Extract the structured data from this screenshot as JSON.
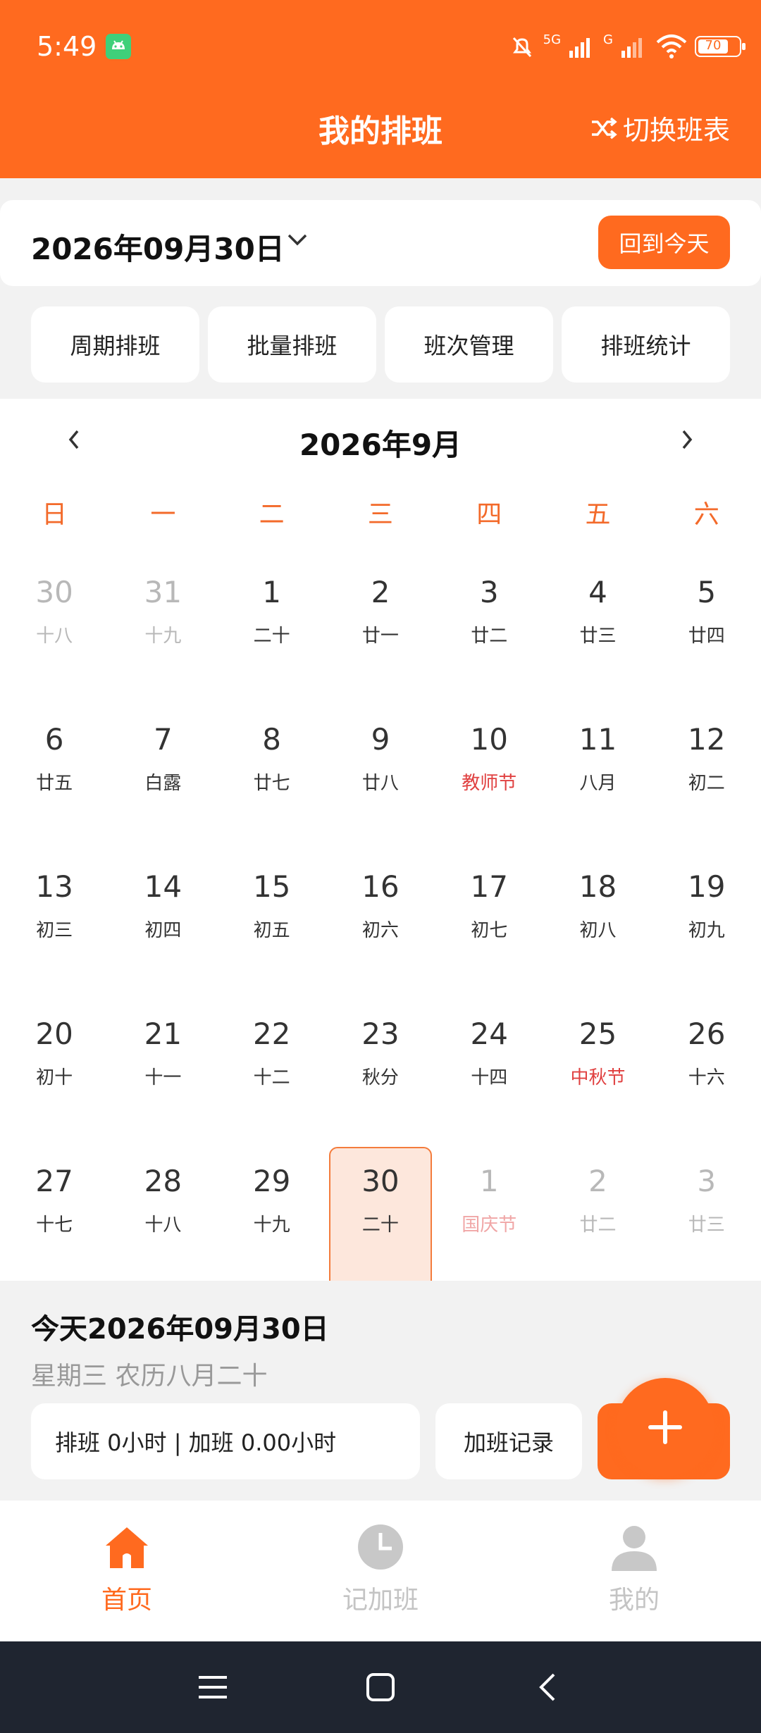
{
  "status": {
    "time": "5:49",
    "network": "5G",
    "network2": "G",
    "battery": "70"
  },
  "header": {
    "title": "我的排班",
    "switch_label": "切换班表"
  },
  "datebar": {
    "date": "2026年09月30日",
    "today_label": "回到今天"
  },
  "quick_actions": [
    {
      "label": "周期排班"
    },
    {
      "label": "批量排班"
    },
    {
      "label": "班次管理"
    },
    {
      "label": "排班统计"
    }
  ],
  "calendar": {
    "month_title": "2026年9月",
    "weekdays": [
      "日",
      "一",
      "二",
      "三",
      "四",
      "五",
      "六"
    ],
    "weeks": [
      [
        {
          "d": "30",
          "s": "十八",
          "muted": true
        },
        {
          "d": "31",
          "s": "十九",
          "muted": true
        },
        {
          "d": "1",
          "s": "二十"
        },
        {
          "d": "2",
          "s": "廿一"
        },
        {
          "d": "3",
          "s": "廿二"
        },
        {
          "d": "4",
          "s": "廿三"
        },
        {
          "d": "5",
          "s": "廿四"
        }
      ],
      [
        {
          "d": "6",
          "s": "廿五"
        },
        {
          "d": "7",
          "s": "白露"
        },
        {
          "d": "8",
          "s": "廿七"
        },
        {
          "d": "9",
          "s": "廿八"
        },
        {
          "d": "10",
          "s": "教师节",
          "holiday": true
        },
        {
          "d": "11",
          "s": "八月"
        },
        {
          "d": "12",
          "s": "初二"
        }
      ],
      [
        {
          "d": "13",
          "s": "初三"
        },
        {
          "d": "14",
          "s": "初四"
        },
        {
          "d": "15",
          "s": "初五"
        },
        {
          "d": "16",
          "s": "初六"
        },
        {
          "d": "17",
          "s": "初七"
        },
        {
          "d": "18",
          "s": "初八"
        },
        {
          "d": "19",
          "s": "初九"
        }
      ],
      [
        {
          "d": "20",
          "s": "初十"
        },
        {
          "d": "21",
          "s": "十一"
        },
        {
          "d": "22",
          "s": "十二"
        },
        {
          "d": "23",
          "s": "秋分"
        },
        {
          "d": "24",
          "s": "十四"
        },
        {
          "d": "25",
          "s": "中秋节",
          "holiday": true
        },
        {
          "d": "26",
          "s": "十六"
        }
      ],
      [
        {
          "d": "27",
          "s": "十七"
        },
        {
          "d": "28",
          "s": "十八"
        },
        {
          "d": "29",
          "s": "十九"
        },
        {
          "d": "30",
          "s": "二十",
          "selected": true
        },
        {
          "d": "1",
          "s": "国庆节",
          "muted": true,
          "holiday": true
        },
        {
          "d": "2",
          "s": "廿二",
          "muted": true
        },
        {
          "d": "3",
          "s": "廿三",
          "muted": true
        }
      ]
    ]
  },
  "today_info": {
    "title": "今天2026年09月30日",
    "subtitle": "星期三 农历八月二十",
    "summary": "排班 0小时 | 加班 0.00小时",
    "records_label": "加班记录"
  },
  "tabs": [
    {
      "label": "首页",
      "icon": "home-icon",
      "active": true
    },
    {
      "label": "记加班",
      "icon": "clock-icon",
      "active": false
    },
    {
      "label": "我的",
      "icon": "person-icon",
      "active": false
    }
  ],
  "colors": {
    "accent": "#ff6a1f",
    "holiday": "#e04040",
    "selected_bg": "#fde7dc"
  }
}
